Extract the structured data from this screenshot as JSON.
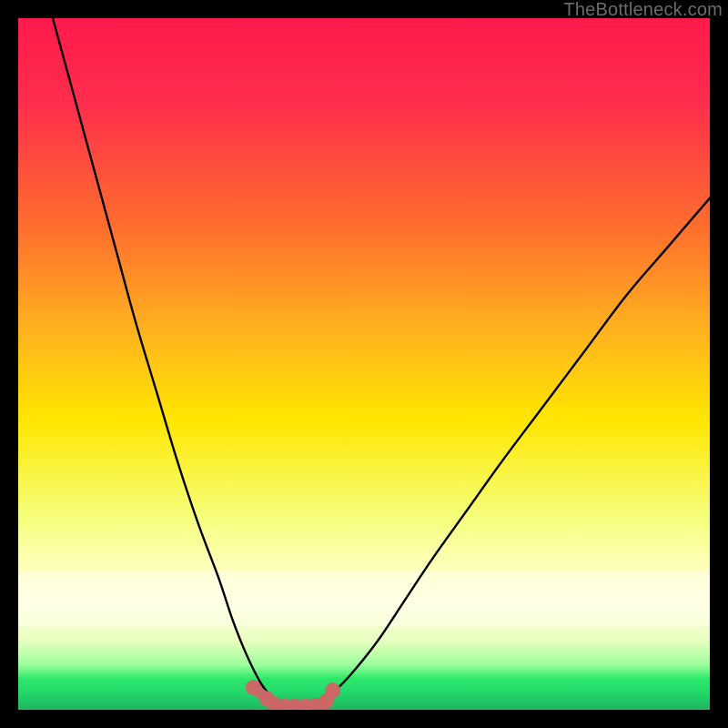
{
  "watermark": "TheBottleneck.com",
  "chart_data": {
    "type": "line",
    "title": "",
    "xlabel": "",
    "ylabel": "",
    "xlim": [
      0,
      100
    ],
    "ylim": [
      0,
      100
    ],
    "background_gradient": {
      "top": "#ff1a4b",
      "mid1": "#ff8a2a",
      "mid2": "#ffe600",
      "lower": "#f6ff7a",
      "band": "#ffffdd",
      "bottom_green": "#2ee86a"
    },
    "series": [
      {
        "name": "curve-left",
        "color": "#000000",
        "x": [
          5,
          8,
          11,
          14,
          17,
          20,
          23,
          26,
          29,
          31,
          33,
          35,
          36.5
        ],
        "values": [
          100,
          89,
          78,
          67,
          56,
          46,
          36,
          27,
          19,
          13,
          8,
          4,
          2
        ]
      },
      {
        "name": "curve-right",
        "color": "#000000",
        "x": [
          45,
          48,
          52,
          56,
          60,
          65,
          70,
          76,
          82,
          88,
          94,
          100
        ],
        "values": [
          2,
          5,
          10,
          16,
          22,
          29,
          36,
          44,
          52,
          60,
          67,
          74
        ]
      },
      {
        "name": "bottom-markers",
        "color": "#cc6666",
        "x": [
          34,
          36,
          37,
          38.5,
          40,
          41.5,
          43,
          44.5,
          45.5
        ],
        "values": [
          3.2,
          1.6,
          0.8,
          0.5,
          0.5,
          0.5,
          0.6,
          1.2,
          2.8
        ]
      }
    ]
  }
}
